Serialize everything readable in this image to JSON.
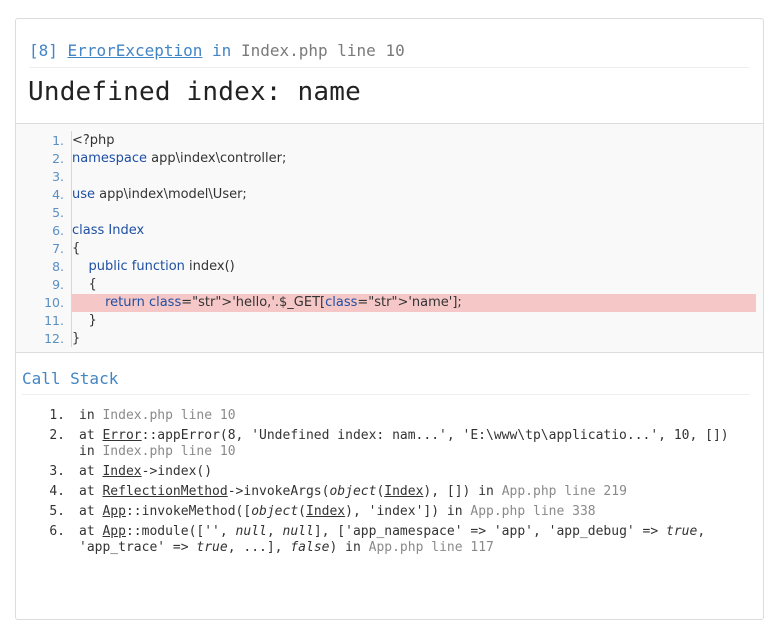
{
  "error": {
    "code": "[8]",
    "type": "ErrorException",
    "in_word": "in",
    "location": "Index.php line 10",
    "message": "Undefined index: name"
  },
  "source_lines": [
    {
      "num": "1.",
      "text": "<?php"
    },
    {
      "num": "2.",
      "text": "namespace app\\index\\controller;"
    },
    {
      "num": "3.",
      "text": ""
    },
    {
      "num": "4.",
      "text": "use app\\index\\model\\User;"
    },
    {
      "num": "5.",
      "text": ""
    },
    {
      "num": "6.",
      "text": "class Index"
    },
    {
      "num": "7.",
      "text": "{"
    },
    {
      "num": "8.",
      "text": "    public function index()"
    },
    {
      "num": "9.",
      "text": "    {"
    },
    {
      "num": "10.",
      "text": "        return 'hello,'.$_GET['name'];"
    },
    {
      "num": "11.",
      "text": "    }"
    },
    {
      "num": "12.",
      "text": "}"
    }
  ],
  "highlighted_line": "10.",
  "call_stack": {
    "title": "Call Stack",
    "frames": [
      {
        "idx": "1.",
        "text": "in Index.php line 10"
      },
      {
        "idx": "2.",
        "line1": "at Error::appError(8, 'Undefined index: nam...', 'E:\\www\\tp\\applicatio...', 10, [])",
        "line2": "in Index.php line 10"
      },
      {
        "idx": "3.",
        "text": "at Index->index()"
      },
      {
        "idx": "4.",
        "text": "at ReflectionMethod->invokeArgs(object(Index), []) in App.php line 219"
      },
      {
        "idx": "5.",
        "text": "at App::invokeMethod([object(Index), 'index']) in App.php line 338"
      },
      {
        "idx": "6.",
        "line1": "at App::module(['', null, null], ['app_namespace' => 'app', 'app_debug' => true,",
        "line2": "'app_trace' => true, ...], false) in App.php line 117"
      }
    ]
  }
}
